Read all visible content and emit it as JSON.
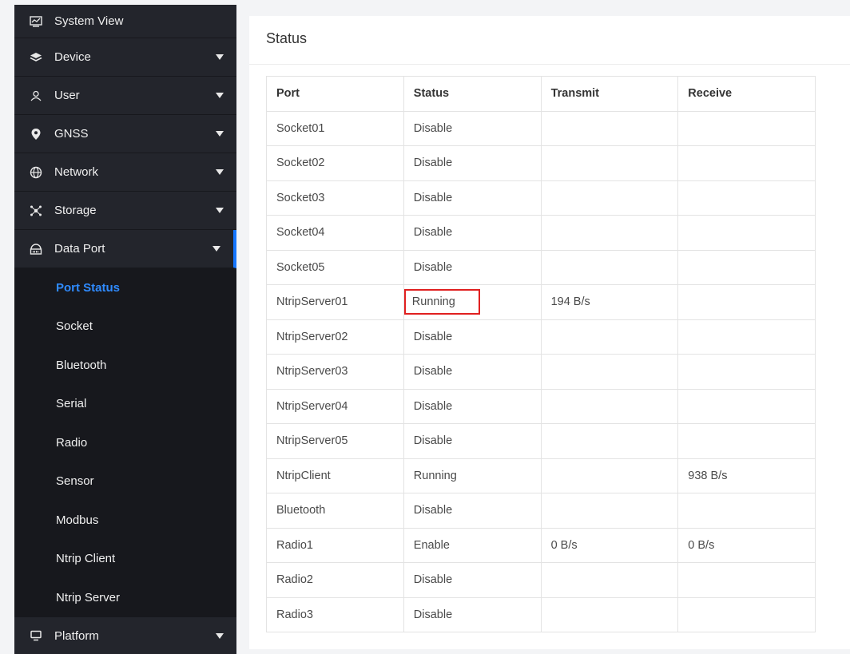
{
  "sidebar": {
    "items": [
      {
        "label": "System View",
        "icon": "chart-monitor-icon",
        "has_caret": false
      },
      {
        "label": "Device",
        "icon": "layers-icon",
        "has_caret": true
      },
      {
        "label": "User",
        "icon": "user-icon",
        "has_caret": true
      },
      {
        "label": "GNSS",
        "icon": "location-pin-icon",
        "has_caret": true
      },
      {
        "label": "Network",
        "icon": "globe-icon",
        "has_caret": true
      },
      {
        "label": "Storage",
        "icon": "storage-nodes-icon",
        "has_caret": true
      },
      {
        "label": "Data Port",
        "icon": "router-icon",
        "has_caret": true,
        "expanded": true
      }
    ],
    "submenu": [
      {
        "label": "Port Status",
        "active": true
      },
      {
        "label": "Socket"
      },
      {
        "label": "Bluetooth"
      },
      {
        "label": "Serial"
      },
      {
        "label": "Radio"
      },
      {
        "label": "Sensor"
      },
      {
        "label": "Modbus"
      },
      {
        "label": "Ntrip Client"
      },
      {
        "label": "Ntrip Server"
      }
    ],
    "footer_item": {
      "label": "Platform",
      "icon": "monitor-icon",
      "has_caret": true
    }
  },
  "main": {
    "title": "Status",
    "table": {
      "headers": [
        "Port",
        "Status",
        "Transmit",
        "Receive"
      ],
      "rows": [
        [
          "Socket01",
          "Disable",
          "",
          ""
        ],
        [
          "Socket02",
          "Disable",
          "",
          ""
        ],
        [
          "Socket03",
          "Disable",
          "",
          ""
        ],
        [
          "Socket04",
          "Disable",
          "",
          ""
        ],
        [
          "Socket05",
          "Disable",
          "",
          ""
        ],
        [
          "NtripServer01",
          "Running",
          "194 B/s",
          ""
        ],
        [
          "NtripServer02",
          "Disable",
          "",
          ""
        ],
        [
          "NtripServer03",
          "Disable",
          "",
          ""
        ],
        [
          "NtripServer04",
          "Disable",
          "",
          ""
        ],
        [
          "NtripServer05",
          "Disable",
          "",
          ""
        ],
        [
          "NtripClient",
          "Running",
          "",
          "938 B/s"
        ],
        [
          "Bluetooth",
          "Disable",
          "",
          ""
        ],
        [
          "Radio1",
          "Enable",
          "0 B/s",
          "0 B/s"
        ],
        [
          "Radio2",
          "Disable",
          "",
          ""
        ],
        [
          "Radio3",
          "Disable",
          "",
          ""
        ]
      ]
    }
  },
  "colors": {
    "sidebar_bg": "#23252c",
    "submenu_bg": "#17181d",
    "accent": "#1677ff",
    "highlight_border": "#e02020"
  }
}
